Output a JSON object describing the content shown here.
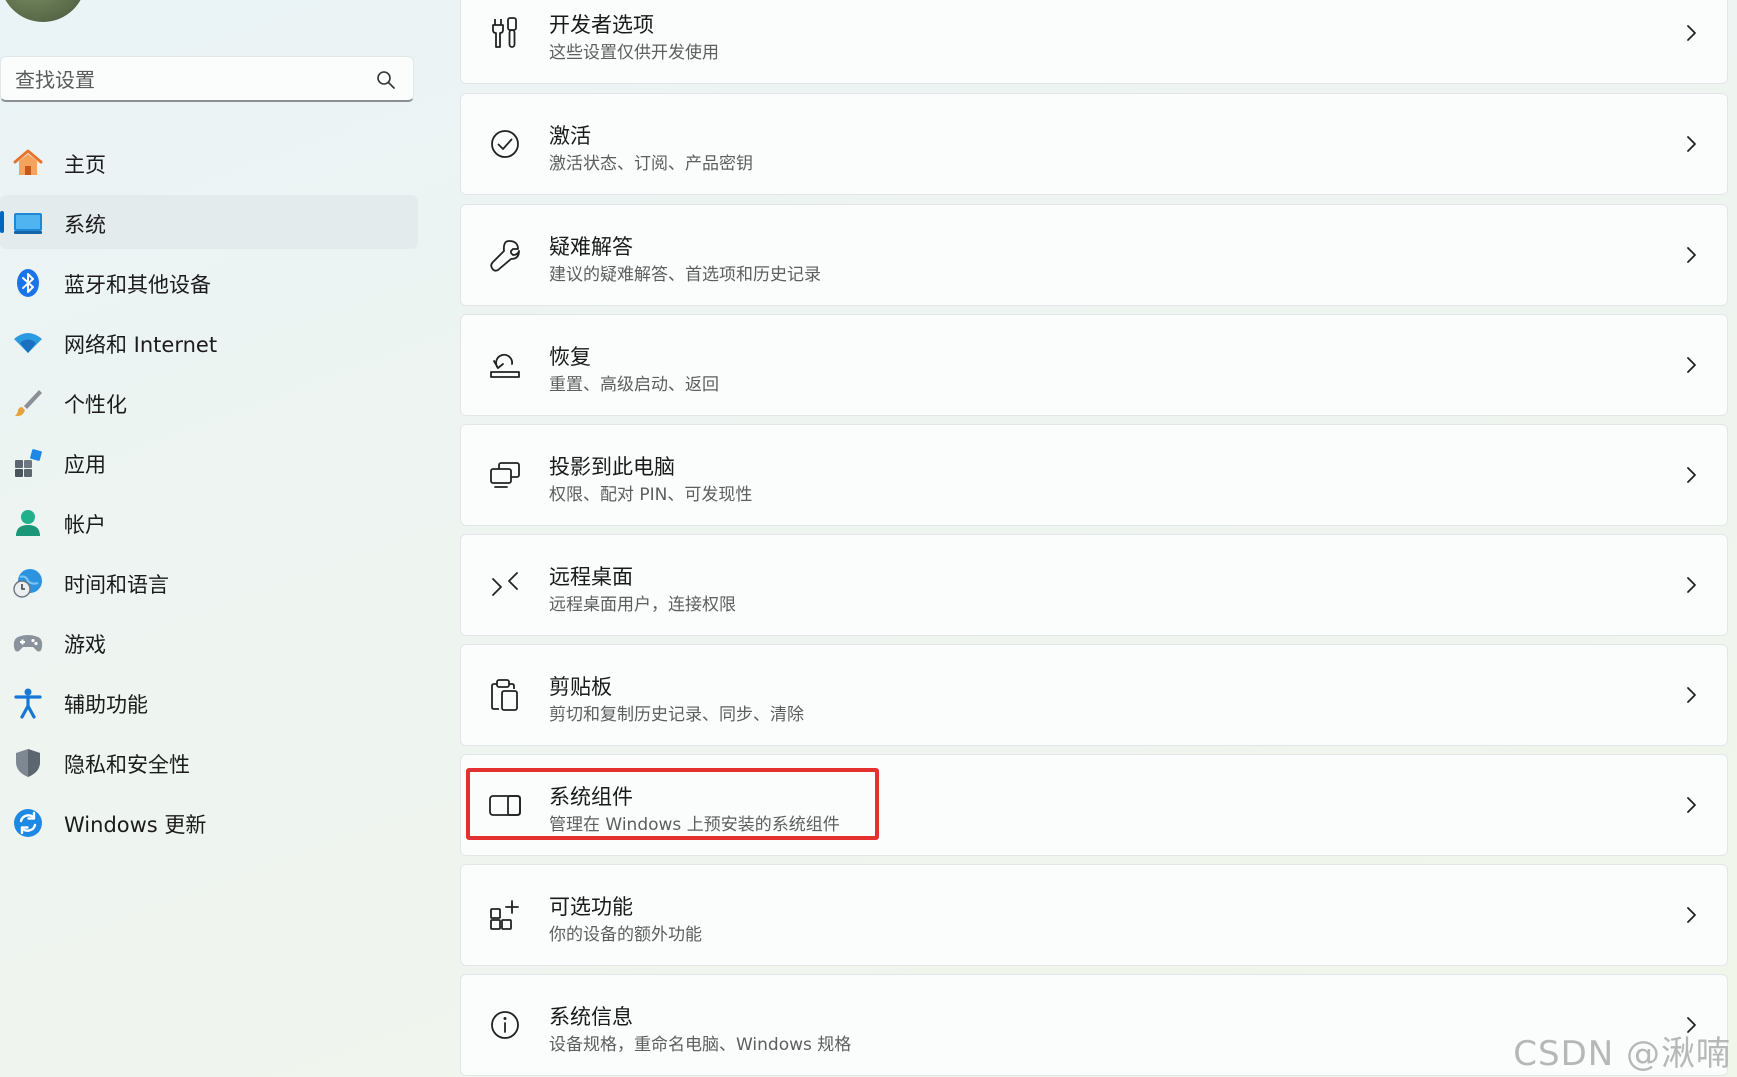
{
  "search": {
    "placeholder": "查找设置"
  },
  "sidebar": {
    "items": [
      {
        "label": "主页",
        "icon": "home-icon",
        "active": false
      },
      {
        "label": "系统",
        "icon": "system-icon",
        "active": true
      },
      {
        "label": "蓝牙和其他设备",
        "icon": "bluetooth-icon",
        "active": false
      },
      {
        "label": "网络和 Internet",
        "icon": "wifi-icon",
        "active": false
      },
      {
        "label": "个性化",
        "icon": "brush-icon",
        "active": false
      },
      {
        "label": "应用",
        "icon": "apps-icon",
        "active": false
      },
      {
        "label": "帐户",
        "icon": "account-icon",
        "active": false
      },
      {
        "label": "时间和语言",
        "icon": "time-language-icon",
        "active": false
      },
      {
        "label": "游戏",
        "icon": "gamepad-icon",
        "active": false
      },
      {
        "label": "辅助功能",
        "icon": "accessibility-icon",
        "active": false
      },
      {
        "label": "隐私和安全性",
        "icon": "shield-icon",
        "active": false
      },
      {
        "label": "Windows 更新",
        "icon": "update-icon",
        "active": false
      }
    ]
  },
  "main": {
    "cards": [
      {
        "title": "开发者选项",
        "desc": "这些设置仅供开发使用",
        "icon": "developer-tools-icon"
      },
      {
        "title": "激活",
        "desc": "激活状态、订阅、产品密钥",
        "icon": "activation-check-icon"
      },
      {
        "title": "疑难解答",
        "desc": "建议的疑难解答、首选项和历史记录",
        "icon": "wrench-icon"
      },
      {
        "title": "恢复",
        "desc": "重置、高级启动、返回",
        "icon": "recovery-icon"
      },
      {
        "title": "投影到此电脑",
        "desc": "权限、配对 PIN、可发现性",
        "icon": "project-screen-icon"
      },
      {
        "title": "远程桌面",
        "desc": "远程桌面用户，连接权限",
        "icon": "remote-desktop-icon"
      },
      {
        "title": "剪贴板",
        "desc": "剪切和复制历史记录、同步、清除",
        "icon": "clipboard-icon"
      },
      {
        "title": "系统组件",
        "desc": "管理在 Windows 上预安装的系统组件",
        "icon": "system-components-icon",
        "highlighted": true
      },
      {
        "title": "可选功能",
        "desc": "你的设备的额外功能",
        "icon": "optional-features-icon"
      },
      {
        "title": "系统信息",
        "desc": "设备规格，重命名电脑、Windows 规格",
        "icon": "info-icon"
      }
    ]
  },
  "watermark": "CSDN @湫喃",
  "colors": {
    "accent": "#0067c0",
    "highlight_border": "#e53030"
  }
}
